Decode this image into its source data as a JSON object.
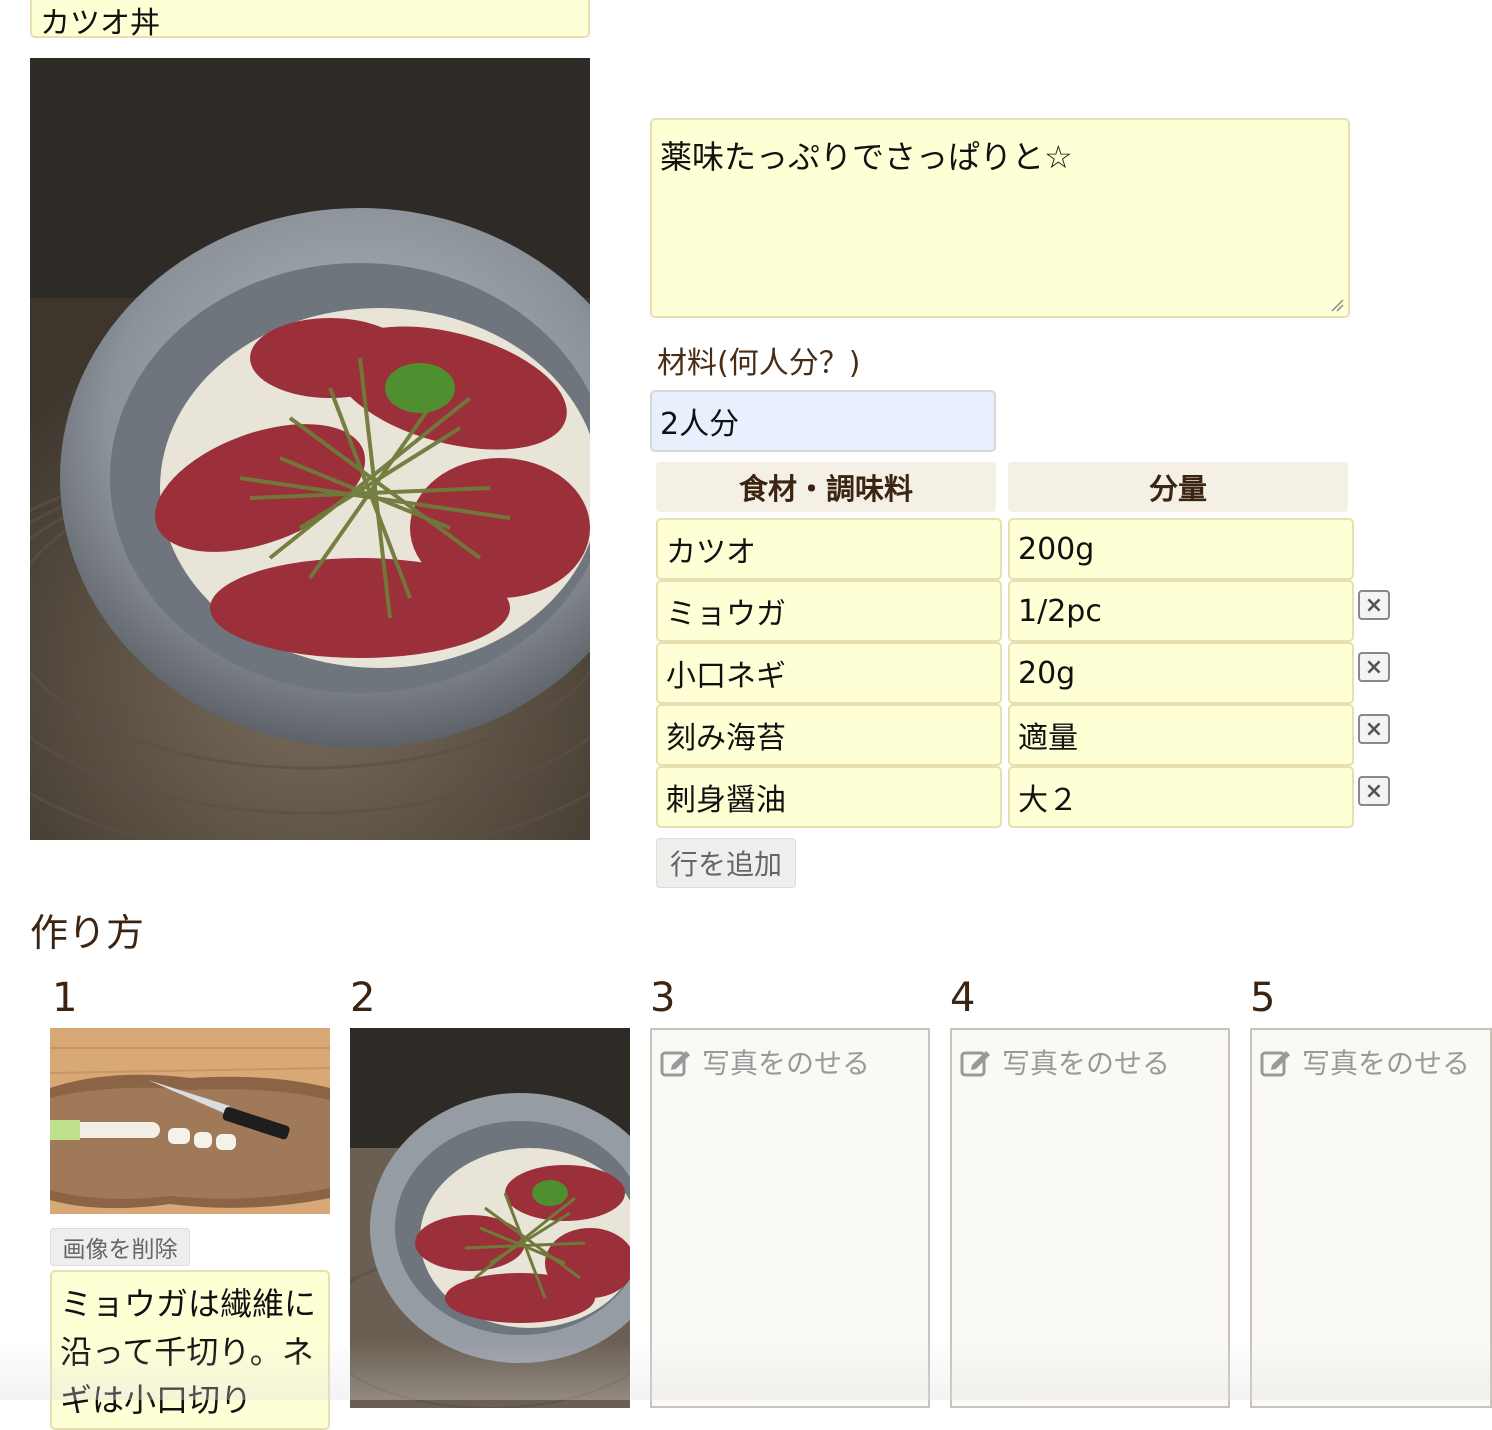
{
  "recipe": {
    "title": "カツオ丼",
    "description": "薬味たっぷりでさっぱりと☆",
    "servings_label": "材料(何人分？)",
    "servings_value": "2人分"
  },
  "ingredients": {
    "header_name": "食材・調味料",
    "header_amount": "分量",
    "rows": [
      {
        "name": "カツオ",
        "amount": "200g"
      },
      {
        "name": "ミョウガ",
        "amount": "1/2pc"
      },
      {
        "name": "小口ネギ",
        "amount": "20g"
      },
      {
        "name": "刻み海苔",
        "amount": "適量"
      },
      {
        "name": "刺身醤油",
        "amount": "大２"
      }
    ],
    "delete_glyph": "×",
    "add_row_label": "行を追加"
  },
  "steps": {
    "heading": "作り方",
    "numbers": [
      "1",
      "2",
      "3",
      "4",
      "5"
    ],
    "placeholder_label": "写真をのせる",
    "delete_image_label": "画像を削除",
    "step1_text": "ミョウガは繊維に沿って千切り。ネギは小口切り"
  },
  "colors": {
    "field_bg": "#ffffd6",
    "header_bg": "#f5f0e6",
    "text_brown": "#3b2412"
  }
}
